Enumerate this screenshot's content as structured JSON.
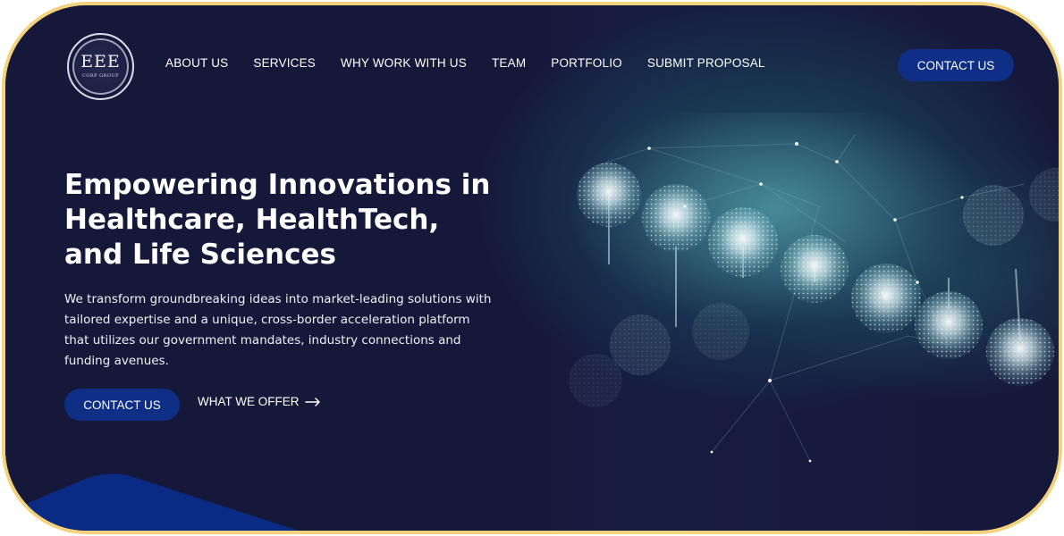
{
  "brand": {
    "logo_main": "EEE",
    "logo_sub": "CORP GROUP"
  },
  "nav": {
    "items": [
      {
        "label": "ABOUT US"
      },
      {
        "label": "SERVICES"
      },
      {
        "label": "WHY WORK WITH US"
      },
      {
        "label": "TEAM"
      },
      {
        "label": "PORTFOLIO"
      },
      {
        "label": "SUBMIT PROPOSAL"
      }
    ],
    "contact_label": "CONTACT US"
  },
  "hero": {
    "headline_line1": "Empowering Innovations in",
    "headline_line2": "Healthcare, HealthTech,",
    "headline_line3": "and Life Sciences",
    "intro": "We transform groundbreaking ideas into market-leading solutions with tailored expertise and a unique, cross-border acceleration platform that utilizes our government mandates, industry connections and funding avenues.",
    "contact_label": "CONTACT US",
    "offer_label": "WHAT WE OFFER",
    "offer_icon": "arrow-right-icon"
  },
  "colors": {
    "background": "#16183a",
    "accent_button": "#0f2f86",
    "frame_border": "#f2d27c",
    "text": "#ffffff"
  }
}
